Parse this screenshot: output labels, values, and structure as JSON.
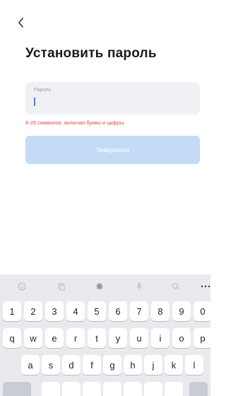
{
  "header": {
    "back_icon": "chevron-left-icon"
  },
  "page": {
    "title": "Установить пароль"
  },
  "password_field": {
    "label": "Пароль",
    "value": "",
    "placeholder": ""
  },
  "hint": {
    "text": "6-20 символов, включая буквы и цифры",
    "color": "#e5484d"
  },
  "submit": {
    "label": "Завершено",
    "color": "#c3dbf5"
  },
  "keyboard": {
    "toolbar_icons": [
      "emoji-icon",
      "clipboard-icon",
      "settings-icon",
      "microphone-icon",
      "search-icon",
      "more-icon"
    ],
    "rows": [
      [
        "1",
        "2",
        "3",
        "4",
        "5",
        "6",
        "7",
        "8",
        "9",
        "0"
      ],
      [
        "q",
        "w",
        "e",
        "r",
        "t",
        "y",
        "u",
        "i",
        "o",
        "p"
      ],
      [
        "a",
        "s",
        "d",
        "f",
        "g",
        "h",
        "j",
        "k",
        "l"
      ]
    ]
  }
}
